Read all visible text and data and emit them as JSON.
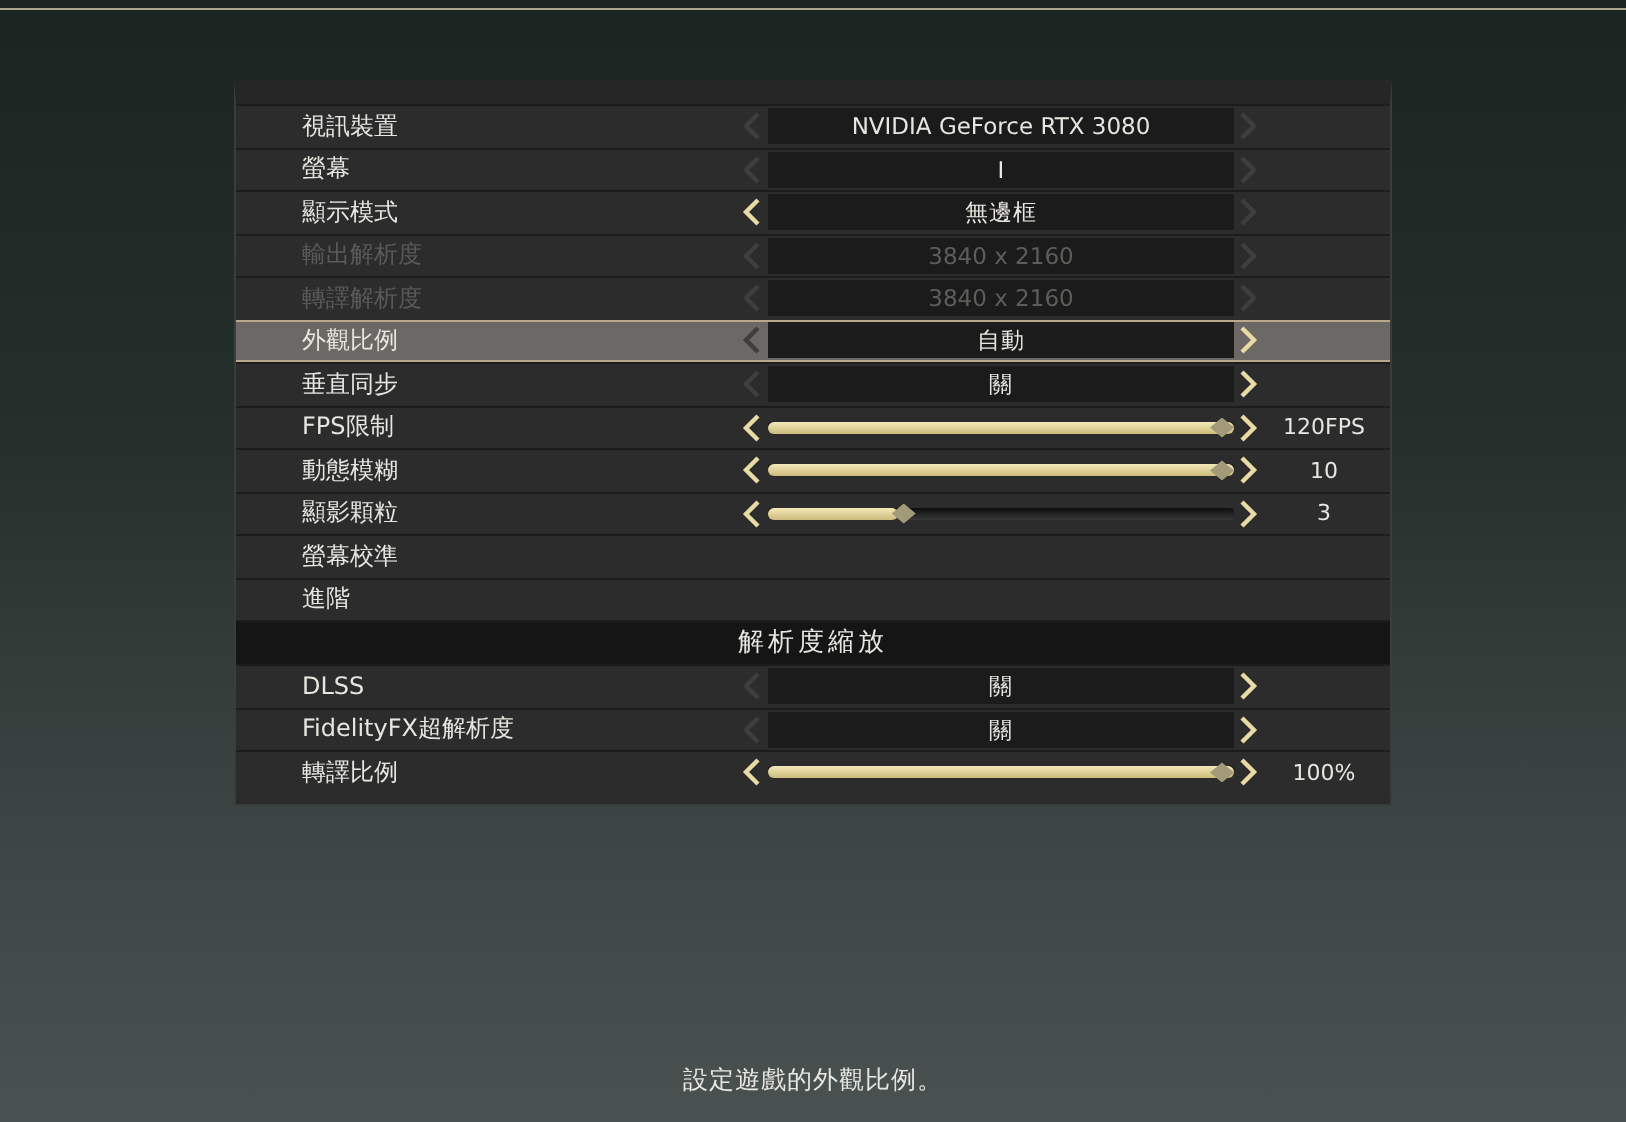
{
  "rows": [
    {
      "kind": "select",
      "label": "視訊裝置",
      "value": "NVIDIA GeForce RTX 3080",
      "left_enabled": false,
      "right_enabled": false,
      "disabled": false,
      "selected": false
    },
    {
      "kind": "select",
      "label": "螢幕",
      "value": "I",
      "left_enabled": false,
      "right_enabled": false,
      "disabled": false,
      "selected": false
    },
    {
      "kind": "select",
      "label": "顯示模式",
      "value": "無邊框",
      "left_enabled": true,
      "right_enabled": false,
      "disabled": false,
      "selected": false
    },
    {
      "kind": "select",
      "label": "輸出解析度",
      "value": "3840 x 2160",
      "left_enabled": false,
      "right_enabled": false,
      "disabled": true,
      "selected": false
    },
    {
      "kind": "select",
      "label": "轉譯解析度",
      "value": "3840 x 2160",
      "left_enabled": false,
      "right_enabled": false,
      "disabled": true,
      "selected": false
    },
    {
      "kind": "select",
      "label": "外觀比例",
      "value": "自動",
      "left_enabled": false,
      "right_enabled": true,
      "disabled": false,
      "selected": true
    },
    {
      "kind": "select",
      "label": "垂直同步",
      "value": "關",
      "left_enabled": false,
      "right_enabled": true,
      "disabled": false,
      "selected": false
    },
    {
      "kind": "slider",
      "label": "FPS限制",
      "level": 1.0,
      "reading": "120FPS",
      "selected": false
    },
    {
      "kind": "slider",
      "label": "動態模糊",
      "level": 1.0,
      "reading": "10",
      "selected": false
    },
    {
      "kind": "slider",
      "label": "顯影顆粒",
      "level": 0.28,
      "reading": "3",
      "selected": false
    },
    {
      "kind": "link",
      "label": "螢幕校準",
      "selected": false
    },
    {
      "kind": "link",
      "label": "進階",
      "selected": false
    },
    {
      "kind": "header",
      "label": "解析度縮放"
    },
    {
      "kind": "select",
      "label": "DLSS",
      "value": "關",
      "left_enabled": false,
      "right_enabled": true,
      "disabled": false,
      "selected": false
    },
    {
      "kind": "select",
      "label": "FidelityFX超解析度",
      "value": "關",
      "left_enabled": false,
      "right_enabled": true,
      "disabled": false,
      "selected": false
    },
    {
      "kind": "slider",
      "label": "轉譯比例",
      "level": 1.0,
      "reading": "100%",
      "selected": false
    }
  ],
  "hint": "設定遊戲的外觀比例。"
}
